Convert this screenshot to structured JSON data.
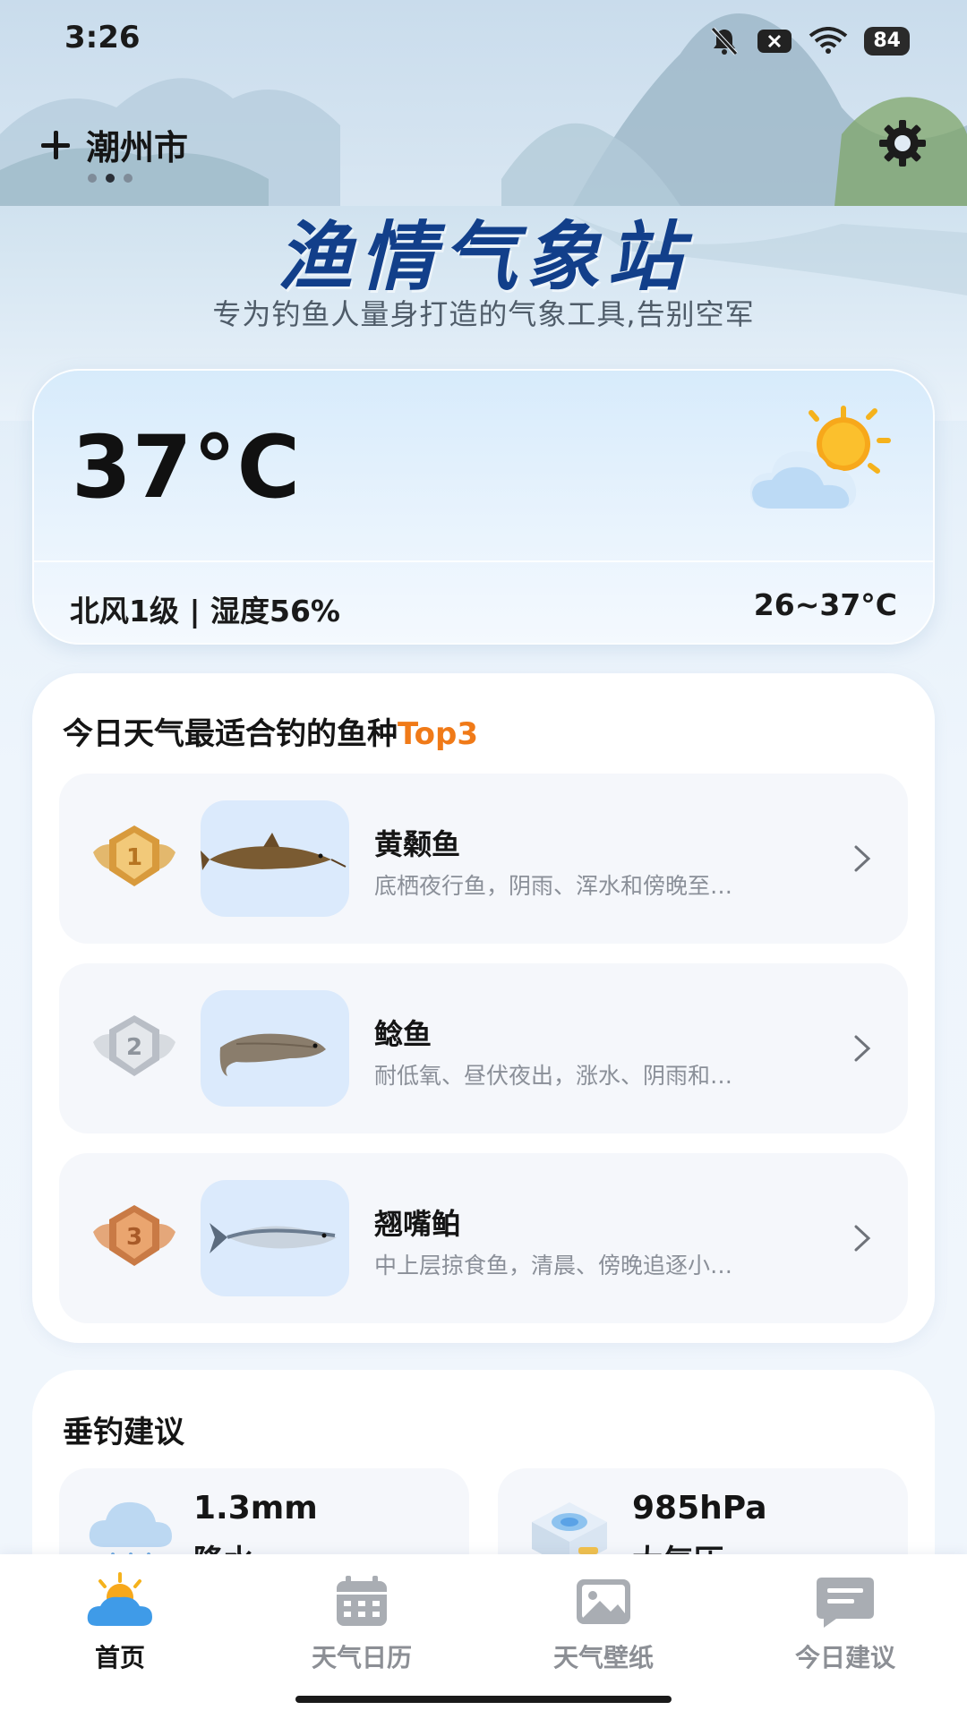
{
  "status_bar": {
    "time": "3:26",
    "battery": "84"
  },
  "top_bar": {
    "city": "潮州市",
    "page_count": 3,
    "active_page": 2
  },
  "header": {
    "title": "渔情气象站",
    "subtitle": "专为钓鱼人量身打造的气象工具,告别空军"
  },
  "weather": {
    "temperature": "37°C",
    "wind_humidity": "北风1级 | 湿度56%",
    "temp_range": "26~37°C",
    "icon": "partly-cloudy-icon"
  },
  "fish": {
    "heading_prefix": "今日天气最适合钓的鱼种",
    "heading_highlight": "Top3",
    "items": [
      {
        "rank": "1",
        "name": "黄颡鱼",
        "desc": "底栖夜行鱼，阴雨、浑水和傍晚至…",
        "medal": "gold-medal-icon"
      },
      {
        "rank": "2",
        "name": "鲶鱼",
        "desc": "耐低氧、昼伏夜出，涨水、阴雨和…",
        "medal": "silver-medal-icon"
      },
      {
        "rank": "3",
        "name": "翘嘴鲌",
        "desc": "中上层掠食鱼，清晨、傍晚追逐小…",
        "medal": "bronze-medal-icon"
      }
    ]
  },
  "advice": {
    "heading": "垂钓建议",
    "tiles": [
      {
        "value": "1.3mm",
        "label": "降水",
        "icon": "rain-cloud-icon"
      },
      {
        "value": "985hPa",
        "label": "大气压",
        "icon": "barometer-icon"
      }
    ]
  },
  "nav": {
    "items": [
      {
        "label": "首页",
        "icon": "home-weather-icon",
        "active": true
      },
      {
        "label": "天气日历",
        "icon": "calendar-icon",
        "active": false
      },
      {
        "label": "天气壁纸",
        "icon": "image-icon",
        "active": false
      },
      {
        "label": "今日建议",
        "icon": "message-icon",
        "active": false
      }
    ]
  },
  "colors": {
    "title": "#123f8a",
    "highlight": "#f07a18",
    "nav_active": "#151515",
    "nav_inactive": "#8c8f95"
  }
}
